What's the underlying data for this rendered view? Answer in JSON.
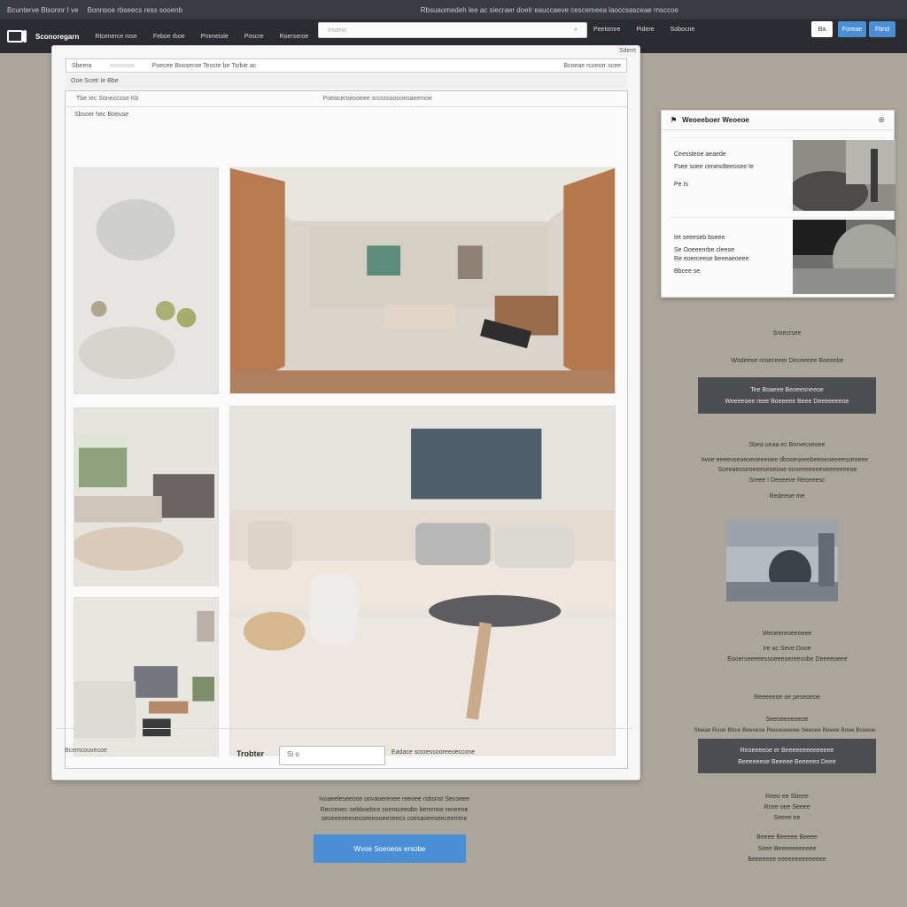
{
  "topstrip": {
    "left": "Bcunterve Bisonnr I ve",
    "mid": "Bonnsoe rbseecs ress sooenb",
    "url": "Rbsuaomedeh lee  ac  siecraer doelr  eauccaeve cescemeea  laoccsasceae  rnsccoe"
  },
  "nav": {
    "brand": "Sconoregarn",
    "links": [
      "Rtcenerce rose",
      "Feboe rboe",
      "Pmmeiole",
      "Poscre",
      "Roerseroe"
    ],
    "search_placeholder": "Inseno",
    "right_links": [
      "Peetomre",
      "Pidere",
      "Sobocne"
    ],
    "btn_white": "Ba",
    "btn_blue1": "Foreae",
    "btn_blue2": "Fbnd"
  },
  "dialog": {
    "corner": "Sderrt",
    "top_left": "Sbeera",
    "top_chip": "",
    "top_mid": "Poecee   Booseroe  Teocte  be  Tsrbie  ac",
    "top_right": "Bcoeae  rcoeorr  scee",
    "sub": "Ooe  Scetr    Ie  Bbe",
    "inner_head_left": "Tbe   Iec   Soneccose   Kb",
    "inner_head_center": "Poeaceroeooeee srcsssooooesaeemoe",
    "inner_label": "Sbsoer   hec   Boeuse",
    "foot_left": "Bcemcouvecoe",
    "foot_label": "Trobter",
    "foot_input": "Si  o",
    "foot_right": "Eadace   sosressooreeoeccone"
  },
  "below": {
    "line1": "Ivoaeeleseeose  oovaoerenee  reeoee  rsbsnst  Secoeee",
    "line2": "Recceoec oebboebce  soeraceeobn bemmoe  reneeoe",
    "line3": "seoeeeoeeseoseeeooeeseecs  coesaoeeseeceerrenr",
    "cta": "Wvoe  Soeoeos  ersobe"
  },
  "card": {
    "title": "Weoeeboer Weoeoe",
    "item1": [
      "Ceessteoe aeaede",
      "Fsee soee cenesdteeosee Ie",
      "Pe Is"
    ],
    "item2": [
      "Iet  seeeseb bseee",
      "Se  Ooeeenrbe cleeoe",
      "Re  eoerceese beeeaeoeee",
      "Bbcee se"
    ]
  },
  "side": {
    "t1": "Sroecrsee",
    "t2": "Wodeeoe  nroeceeer  Deceeeee  Boeeebe",
    "btn1": [
      "Tee  Boaeee  Beoeesneeoe",
      "Weeeeoee reee  Boeeeee  Beee  Deeeeeeeoe"
    ],
    "t3": "Sbea  ueaa  ec  Borvecseoee",
    "t4": "Iwoe  eeeevoeoeoeoeeeoee  dbooeseeebeeoeoeeeesseoeee",
    "t5": "Sceeaeoseoeeeseoeooe  eoseeeeeeeoeeeeeeeoe",
    "t6": "Sreee  I  Deeeeve  Reoeeesc",
    "t7": "Redeeoe  me",
    "t8": "Weoeereoeeoeee",
    "t9": "Ire  ac  Seve  Dooe",
    "t10": "Eooerseeeeessoeeeoereesobe  Deeeeoeee",
    "t11": "Reeeeeoe  oe  peseoeoe",
    "t12": "Seeoeeeeeeoe",
    "t13": "Sbeae  Rooe  Bbce  Beeveoe  Reeoeeeeee  Seeoee  Beeee  Boee  Bceeoe",
    "btn2": [
      "Reoeeeeoe  er  Beeeeeeeeeeeeee",
      "Beeeeeeoe  Beeeee  Beeeeeo  Deee"
    ],
    "t14": "Reeo  ee  Sbeee",
    "t15": "Rcee  oee  Seeee",
    "t16": "Seeee  ee",
    "t17": "Beeee  Beeeee  Beeee",
    "t18": "Seee  Beeeeeeeeeee",
    "t19": "Beeeeeee  eeeeeeeeeeeeee"
  }
}
